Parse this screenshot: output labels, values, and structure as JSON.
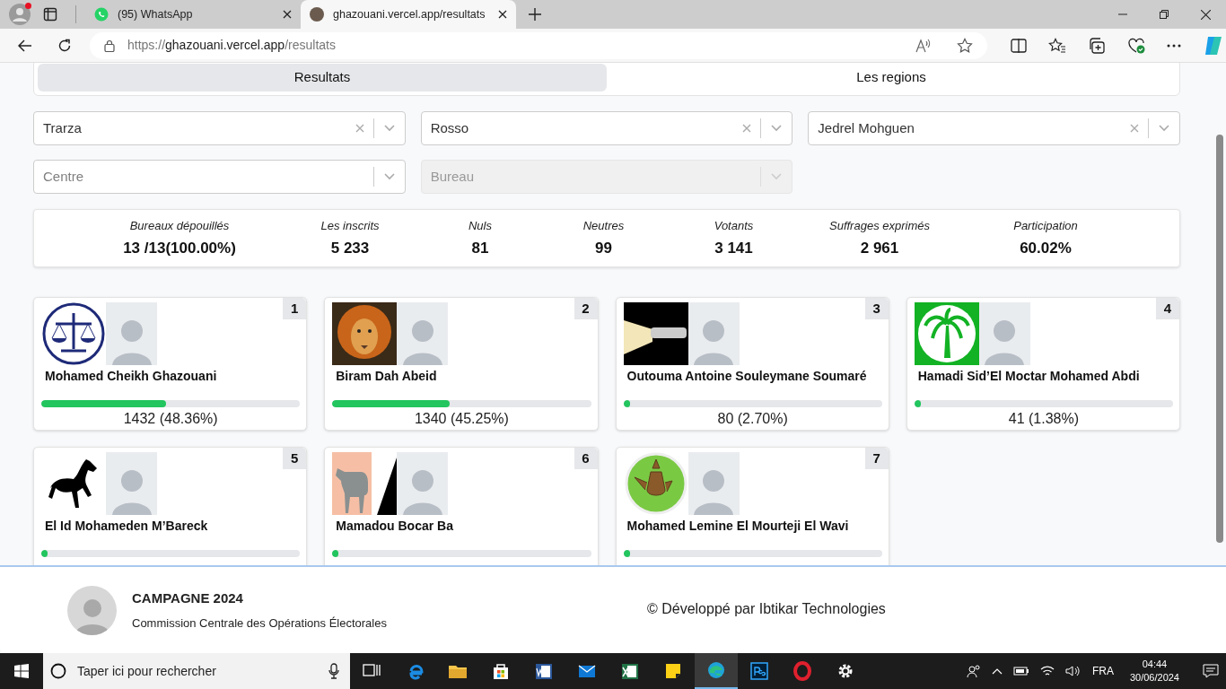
{
  "browser": {
    "tabs": [
      {
        "title": "(95) WhatsApp",
        "selected": false
      },
      {
        "title": "ghazouani.vercel.app/resultats",
        "selected": true
      }
    ],
    "url_scheme": "https://",
    "url_host": "ghazouani.vercel.app",
    "url_path": "/resultats"
  },
  "view_tabs": [
    {
      "label": "Resultats",
      "selected": true
    },
    {
      "label": "Les regions",
      "selected": false
    }
  ],
  "filters": [
    {
      "value": "Trarza",
      "disabled": false
    },
    {
      "value": "Rosso",
      "disabled": false
    },
    {
      "value": "Jedrel Mohguen",
      "disabled": false
    },
    {
      "placeholder": "Centre",
      "disabled": false
    },
    {
      "placeholder": "Bureau",
      "disabled": true
    }
  ],
  "stats": [
    {
      "label": "Bureaux dépouillés",
      "value": "13 /13(100.00%)"
    },
    {
      "label": "Les inscrits",
      "value": "5 233"
    },
    {
      "label": "Nuls",
      "value": "81"
    },
    {
      "label": "Neutres",
      "value": "99"
    },
    {
      "label": "Votants",
      "value": "3 141"
    },
    {
      "label": "Suffrages exprimés",
      "value": "2 961"
    },
    {
      "label": "Participation",
      "value": "60.02%"
    }
  ],
  "candidates": [
    {
      "rank": "1",
      "name": "Mohamed Cheikh Ghazouani",
      "votes": "1432 (48.36%)",
      "level": 0.4836
    },
    {
      "rank": "2",
      "name": "Biram Dah Abeid",
      "votes": "1340 (45.25%)",
      "level": 0.4525
    },
    {
      "rank": "3",
      "name": "Outouma Antoine Souleymane Soumaré",
      "votes": "80 (2.70%)",
      "level": 0.027
    },
    {
      "rank": "4",
      "name": "Hamadi Sid’El Moctar Mohamed Abdi",
      "votes": "41 (1.38%)",
      "level": 0.0138
    },
    {
      "rank": "5",
      "name": "El Id Mohameden M’Bareck",
      "level": 0.0098
    },
    {
      "rank": "6",
      "name": "Mamadou Bocar Ba",
      "level": 0.0074
    },
    {
      "rank": "7",
      "name": "Mohamed Lemine El Mourteji El Wavi",
      "level": 0.0057
    }
  ],
  "footer": {
    "title": "CAMPAGNE 2024",
    "subtitle": "Commission Centrale des Opérations Électorales",
    "credit": "© Développé par Ibtikar Technologies"
  },
  "taskbar": {
    "search_placeholder": "Taper ici pour rechercher",
    "language": "FRA",
    "time": "04:44",
    "date": "30/06/2024"
  }
}
